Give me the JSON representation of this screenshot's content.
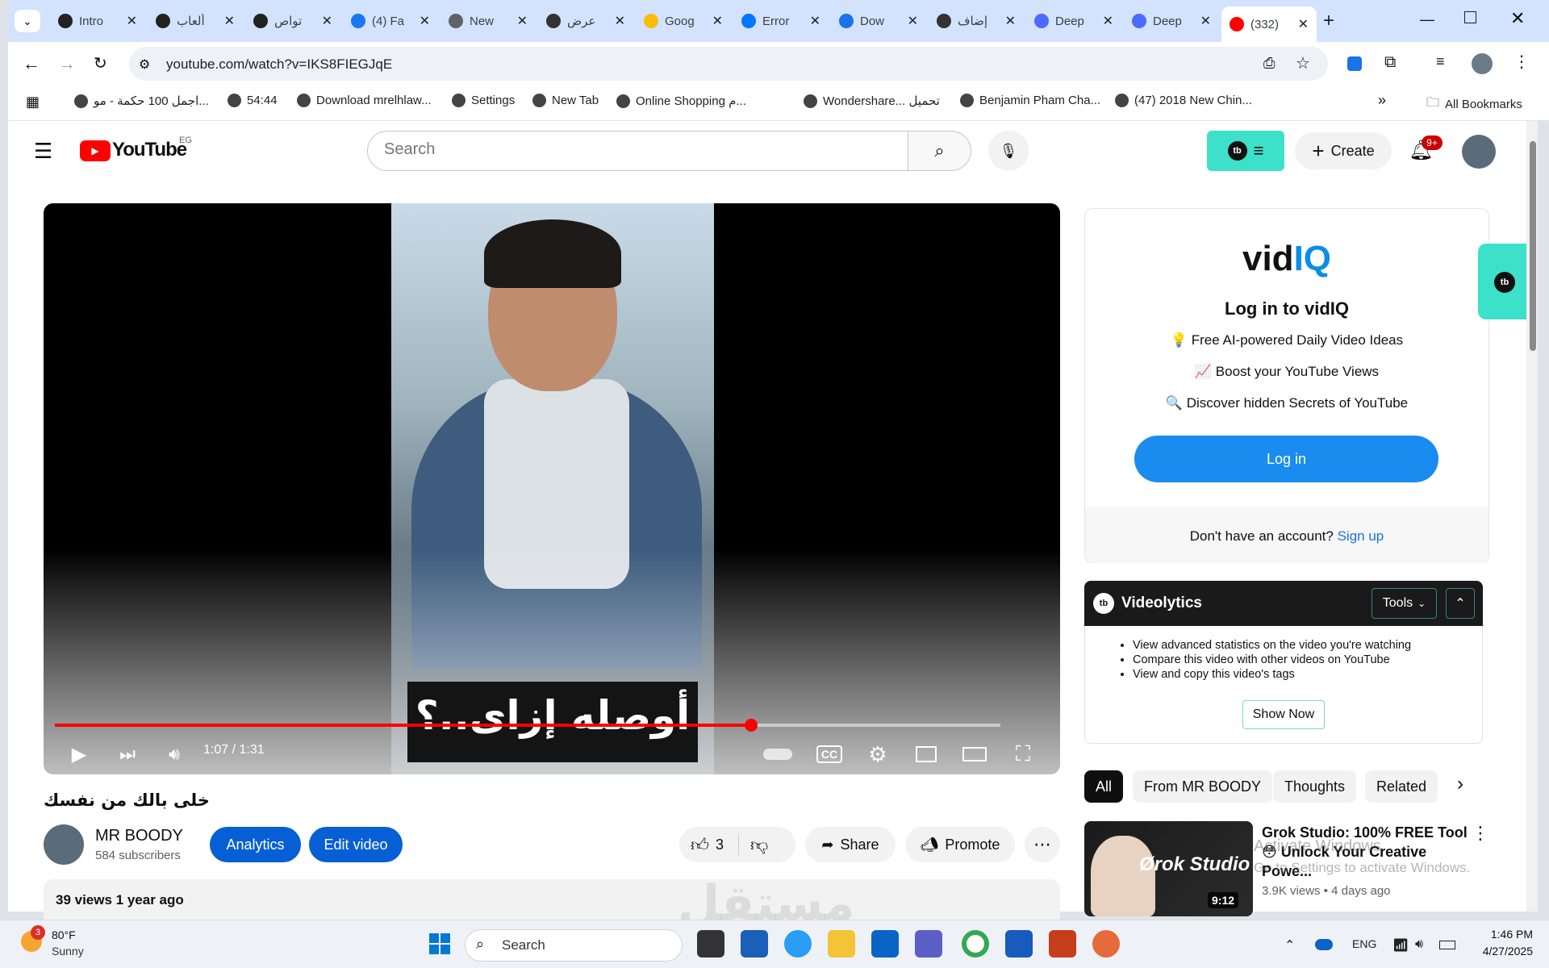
{
  "browser": {
    "tabs": [
      {
        "label": "Intro",
        "icon": "openai-icon"
      },
      {
        "label": "ألعاب",
        "icon": "openai-icon"
      },
      {
        "label": "تواص",
        "icon": "openai-icon"
      },
      {
        "label": "(4) Fa",
        "icon": "facebook-icon"
      },
      {
        "label": "New",
        "icon": "chrome-icon"
      },
      {
        "label": "عرض",
        "icon": "site-icon"
      },
      {
        "label": "Goog",
        "icon": "drive-icon"
      },
      {
        "label": "Error",
        "icon": "vk-icon"
      },
      {
        "label": "Dow",
        "icon": "download-icon"
      },
      {
        "label": "إضاف",
        "icon": "site-icon"
      },
      {
        "label": "Deep",
        "icon": "deepseek-icon"
      },
      {
        "label": "Deep",
        "icon": "deepseek-icon"
      },
      {
        "label": "(332)",
        "icon": "youtube-icon",
        "active": true
      }
    ],
    "url": "youtube.com/watch?v=IKS8FIEGJqE",
    "bookmarks": [
      "اجمل 100 حكمة - مو...",
      "54:44",
      "Download mrelhlaw...",
      "Settings",
      "New Tab",
      "Online Shopping م...",
      "Wondershare... تحميل",
      "Benjamin Pham Cha...",
      "(47) 2018 New Chin..."
    ],
    "all_bookmarks": "All Bookmarks"
  },
  "youtube": {
    "logo": "YouTube",
    "country": "EG",
    "search_placeholder": "Search",
    "create_label": "Create",
    "notif_count": "9+",
    "video": {
      "subtitle_text": "أوصله إزاى..؟",
      "time": "1:07 / 1:31",
      "progress_fraction": 0.7363,
      "title": "خلى بالك من نفسك"
    },
    "channel": {
      "name": "MR BOODY",
      "subscribers": "584 subscribers"
    },
    "actions": {
      "analytics": "Analytics",
      "edit": "Edit video",
      "likes": "3",
      "share": "Share",
      "promote": "Promote"
    },
    "views": "39 views  1 year ago"
  },
  "vidiq": {
    "logo_vid": "vid",
    "logo_iq": "IQ",
    "title": "Log in to vidIQ",
    "features": [
      "💡 Free AI-powered Daily Video Ideas",
      "📈 Boost your YouTube Views",
      "🔍 Discover hidden Secrets of YouTube"
    ],
    "login": "Log in",
    "no_account": "Don't have an account?",
    "signup": "Sign up"
  },
  "videolytics": {
    "title": "Videolytics",
    "tools": "Tools",
    "items": [
      "View advanced statistics on the video you're watching",
      "Compare this video with other videos on YouTube",
      "View and copy this video's tags"
    ],
    "show_now": "Show Now"
  },
  "chips": [
    "All",
    "From MR BOODY",
    "Thoughts",
    "Related"
  ],
  "related": {
    "title": "Grok Studio: 100% FREE Tool 😳 Unlock Your Creative Powe...",
    "thumb_brand": "Ørok Studio",
    "duration": "9:12",
    "meta": "3.9K views  •  4 days ago"
  },
  "overlay": {
    "activate1": "Activate Windows",
    "activate2": "Go to Settings to activate Windows.",
    "watermark": "مستقل"
  },
  "taskbar": {
    "temp": "80°F",
    "condition": "Sunny",
    "weather_badge": "3",
    "search": "Search",
    "lang": "ENG",
    "time": "1:46 PM",
    "date": "4/27/2025"
  }
}
